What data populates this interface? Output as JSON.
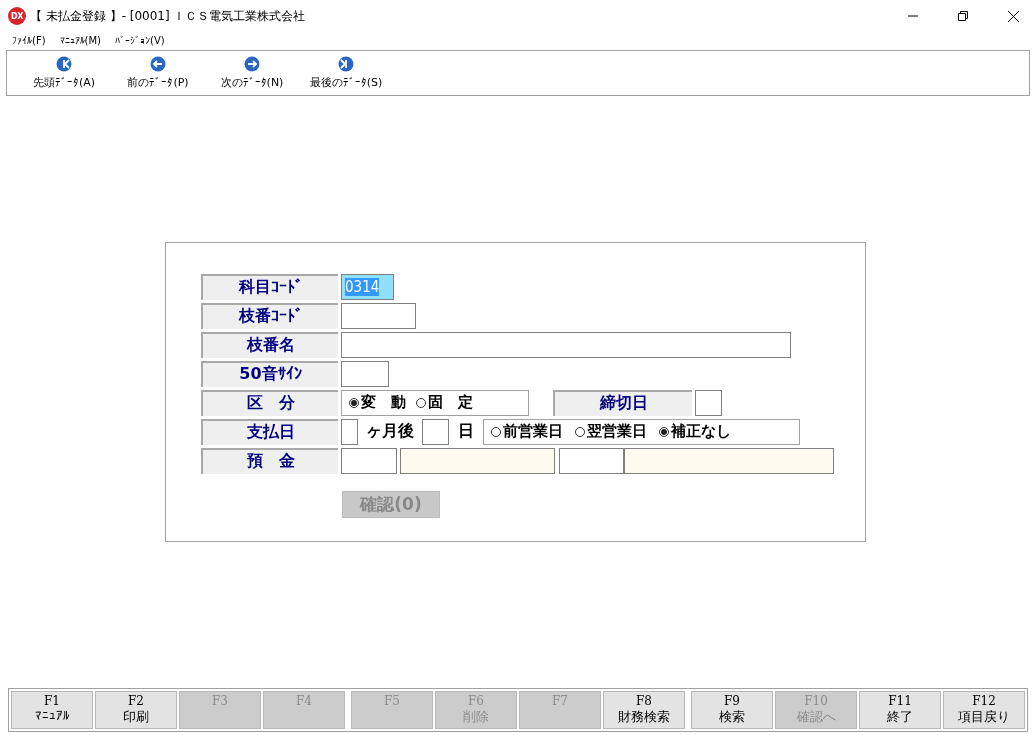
{
  "window": {
    "icon_text": "DX",
    "title": "【 未払金登録 】- [0001] ＩＣＳ電気工業株式会社"
  },
  "menu": [
    "ﾌｧｲﾙ(F)",
    "ﾏﾆｭｱﾙ(M)",
    "ﾊﾞｰｼﾞｮﾝ(V)"
  ],
  "toolbar": [
    {
      "kind": "first",
      "label": "先頭ﾃﾞｰﾀ(A)"
    },
    {
      "kind": "prev",
      "label": "前のﾃﾞｰﾀ(P)"
    },
    {
      "kind": "next",
      "label": "次のﾃﾞｰﾀ(N)"
    },
    {
      "kind": "last",
      "label": "最後のﾃﾞｰﾀ(S)"
    }
  ],
  "form": {
    "account_code": {
      "label": "科目ｺｰﾄﾞ",
      "value": "0314",
      "focused": true
    },
    "branch_code": {
      "label": "枝番ｺｰﾄﾞ"
    },
    "branch_name": {
      "label": "枝番名"
    },
    "kana_sign": {
      "label": "50音ｻｲﾝ"
    },
    "category": {
      "label": "区　分",
      "options": [
        {
          "label": "変　動",
          "selected": true
        },
        {
          "label": "固　定",
          "selected": false
        }
      ]
    },
    "closing_day": {
      "label": "締切日"
    },
    "payment_day": {
      "label": "支払日",
      "months_after": "ヶ月後",
      "day": "日",
      "options": [
        {
          "label": "前営業日",
          "selected": false
        },
        {
          "label": "翌営業日",
          "selected": false
        },
        {
          "label": "補正なし",
          "selected": true
        }
      ]
    },
    "deposit": {
      "label": "預　金"
    },
    "confirm_button": {
      "label": "確認(0)",
      "disabled": true
    }
  },
  "function_keys": [
    {
      "key": "F1",
      "label": "ﾏﾆｭｱﾙ",
      "disabled": false
    },
    {
      "key": "F2",
      "label": "印刷",
      "disabled": false
    },
    {
      "key": "F3",
      "disabled": true
    },
    {
      "key": "F4",
      "disabled": true
    },
    {
      "key": "F5",
      "disabled": true
    },
    {
      "key": "F6",
      "label": "削除",
      "disabled": true
    },
    {
      "key": "F7",
      "disabled": true
    },
    {
      "key": "F8",
      "label": "財務検索",
      "disabled": false
    },
    {
      "key": "F9",
      "label": "検索",
      "disabled": false
    },
    {
      "key": "F10",
      "label": "確認へ",
      "disabled": true
    },
    {
      "key": "F11",
      "label": "終了",
      "disabled": false
    },
    {
      "key": "F12",
      "label": "項目戻り",
      "disabled": false
    }
  ]
}
